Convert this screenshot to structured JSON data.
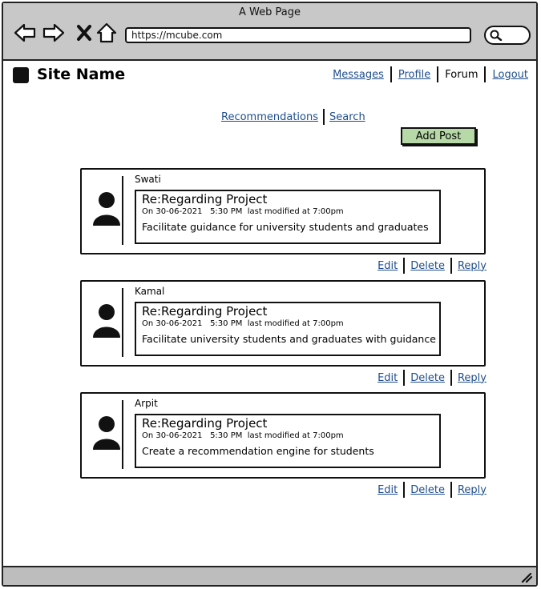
{
  "browser": {
    "window_title": "A Web Page",
    "url": "https://mcube.com"
  },
  "site": {
    "name": "Site Name"
  },
  "nav": {
    "messages": "Messages",
    "profile": "Profile",
    "forum": "Forum",
    "logout": "Logout"
  },
  "subnav": {
    "recommendations": "Recommendations",
    "search": "Search"
  },
  "add_post_label": "Add Post",
  "posts": [
    {
      "author": "Swati",
      "subject": "Re:Regarding Project",
      "date": "On 30-06-2021",
      "time": "5:30 PM",
      "modified": "last modified at 7:00pm",
      "body": "Facilitate guidance for university students and graduates"
    },
    {
      "author": "Kamal",
      "subject": "Re:Regarding Project",
      "date": "On 30-06-2021",
      "time": "5:30 PM",
      "modified": "last modified at 7:00pm",
      "body": "Facilitate university students and graduates with guidance"
    },
    {
      "author": "Arpit",
      "subject": "Re:Regarding Project",
      "date": "On 30-06-2021",
      "time": "5:30 PM",
      "modified": "last modified at 7:00pm",
      "body": "Create a recommendation engine for students"
    }
  ],
  "actions": {
    "edit": "Edit",
    "delete": "Delete",
    "reply": "Reply"
  },
  "colors": {
    "link": "#1f4e8c",
    "add_post_bg": "#b7d9a8",
    "chrome_bg": "#c8c8c8"
  }
}
